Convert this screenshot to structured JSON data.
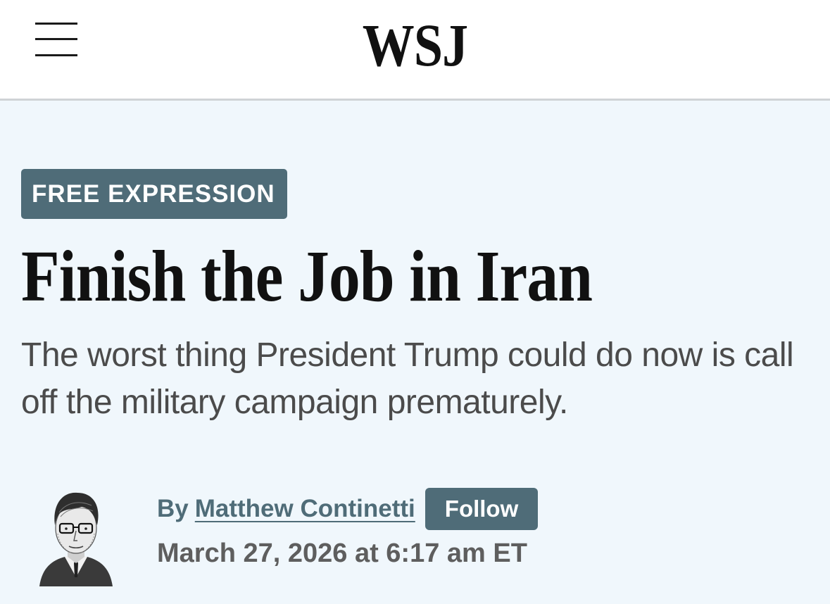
{
  "header": {
    "logo": "WSJ",
    "menu_icon": "hamburger-menu-icon"
  },
  "article": {
    "section": "FREE EXPRESSION",
    "headline": "Finish the Job in Iran",
    "dek": "The worst thing President Trump could do now is call off the military campaign prematurely.",
    "byline_prefix": "By",
    "author": "Matthew Continetti",
    "follow_label": "Follow",
    "timestamp": "March 27, 2026 at 6:17 am ET"
  },
  "colors": {
    "page_background": "#f0f7fc",
    "accent": "#4f6c78",
    "headline": "#111111",
    "dek": "#4b4b4b"
  }
}
